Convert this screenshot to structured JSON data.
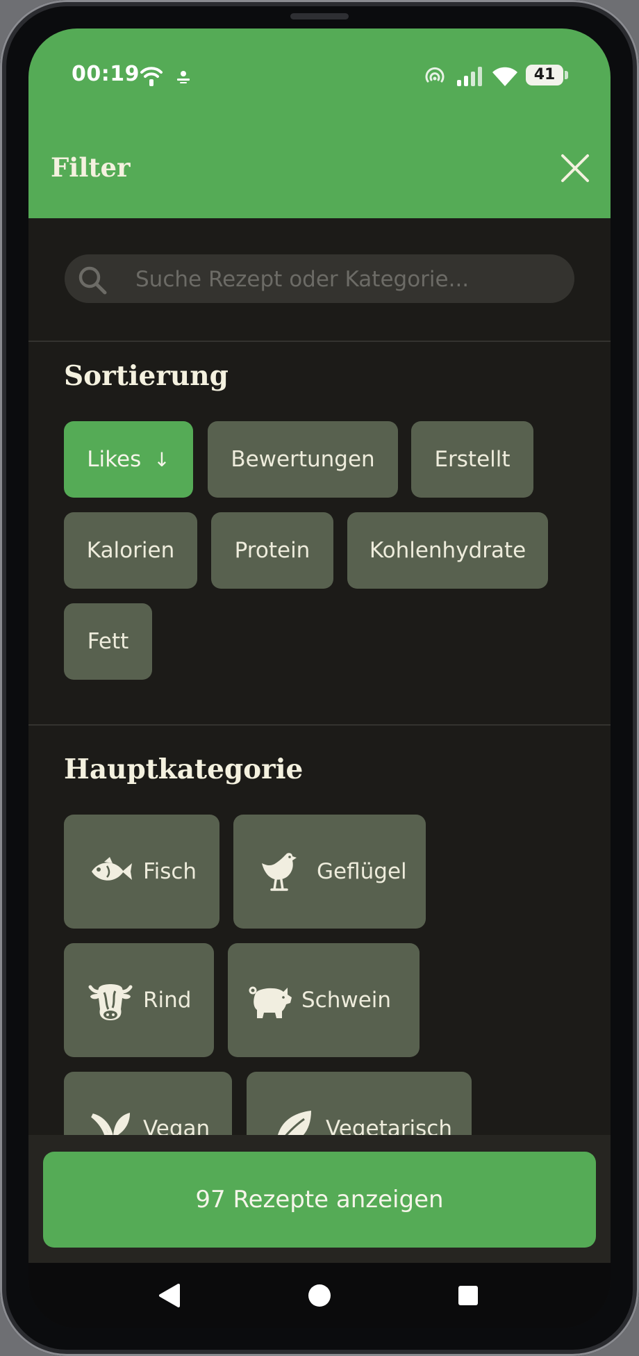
{
  "status_bar": {
    "time": "00:19",
    "battery": "41"
  },
  "header": {
    "title": "Filter"
  },
  "search": {
    "placeholder": "Suche Rezept oder Kategorie..."
  },
  "sorting": {
    "title": "Sortierung",
    "chips": [
      {
        "label": "Likes",
        "active": true,
        "arrow": "↓"
      },
      {
        "label": "Bewertungen"
      },
      {
        "label": "Erstellt"
      },
      {
        "label": "Kalorien"
      },
      {
        "label": "Protein"
      },
      {
        "label": "Kohlenhydrate"
      },
      {
        "label": "Fett"
      }
    ]
  },
  "main_category": {
    "title": "Hauptkategorie",
    "items": [
      {
        "label": "Fisch",
        "icon": "fish-icon"
      },
      {
        "label": "Geflügel",
        "icon": "chicken-icon"
      },
      {
        "label": "Rind",
        "icon": "cow-icon"
      },
      {
        "label": "Schwein",
        "icon": "pig-icon"
      },
      {
        "label": "Vegan",
        "icon": "sprout-icon"
      },
      {
        "label": "Vegetarisch",
        "icon": "leaf-icon"
      }
    ]
  },
  "footer": {
    "cta_label": "97 Rezepte anzeigen"
  },
  "colors": {
    "accent": "#55ab56",
    "chip": "#58614f",
    "background": "#1c1b18",
    "text": "#f4f1df"
  }
}
